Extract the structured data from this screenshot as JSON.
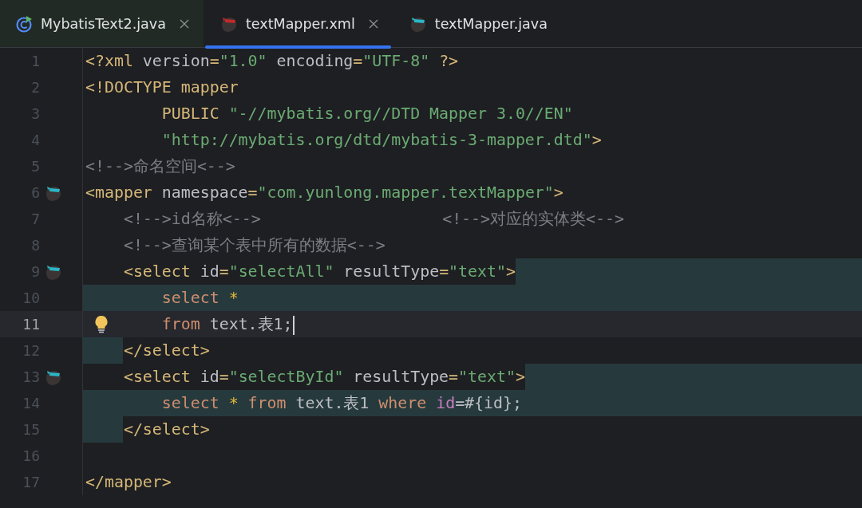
{
  "tabs": [
    {
      "label": "MybatisText2.java",
      "kind": "java",
      "selected": false,
      "tinted": true,
      "closable": true
    },
    {
      "label": "textMapper.xml",
      "kind": "xml",
      "selected": true,
      "tinted": false,
      "closable": true
    },
    {
      "label": "textMapper.java",
      "kind": "mapper",
      "selected": false,
      "tinted": false,
      "closable": false
    }
  ],
  "lines": [
    {
      "number": "1",
      "tokens": [
        {
          "kind": "tag",
          "text": "<?xml "
        },
        {
          "kind": "attr",
          "text": "version"
        },
        {
          "kind": "tag",
          "text": "="
        },
        {
          "kind": "str",
          "text": "\"1.0\""
        },
        {
          "kind": "attr",
          "text": " encoding"
        },
        {
          "kind": "tag",
          "text": "="
        },
        {
          "kind": "str",
          "text": "\"UTF-8\""
        },
        {
          "kind": "tag",
          "text": " ?>"
        }
      ]
    },
    {
      "number": "2",
      "tokens": [
        {
          "kind": "tag",
          "text": "<!DOCTYPE mapper"
        }
      ]
    },
    {
      "number": "3",
      "tokens": [
        {
          "kind": "tag",
          "text": "        PUBLIC "
        },
        {
          "kind": "str",
          "text": "\"-//mybatis.org//DTD Mapper 3.0//EN\""
        }
      ]
    },
    {
      "number": "4",
      "tokens": [
        {
          "kind": "str",
          "text": "        \"http://mybatis.org/dtd/mybatis-3-mapper.dtd\""
        },
        {
          "kind": "tag",
          "text": ">"
        }
      ]
    },
    {
      "number": "5",
      "tokens": [
        {
          "kind": "comment",
          "text": "<!-->命名空间<-->"
        }
      ]
    },
    {
      "number": "6",
      "mapper_icon": true,
      "tokens": [
        {
          "kind": "tag",
          "text": "<mapper "
        },
        {
          "kind": "attr",
          "text": "namespace"
        },
        {
          "kind": "tag",
          "text": "="
        },
        {
          "kind": "str",
          "text": "\"com.yunlong.mapper.textMapper\""
        },
        {
          "kind": "tag",
          "text": ">"
        }
      ]
    },
    {
      "number": "7",
      "tokens": [
        {
          "kind": "comment",
          "text": "    <!-->id名称<-->                   <!-->对应的实体类<-->"
        }
      ]
    },
    {
      "number": "8",
      "tokens": [
        {
          "kind": "comment",
          "text": "    <!-->查询某个表中所有的数据<-->"
        }
      ]
    },
    {
      "number": "9",
      "mapper_icon": true,
      "shade_tail": true,
      "tokens": [
        {
          "kind": "tag",
          "text": "    <select "
        },
        {
          "kind": "attr",
          "text": "id"
        },
        {
          "kind": "tag",
          "text": "="
        },
        {
          "kind": "str",
          "text": "\"selectAll\""
        },
        {
          "kind": "attr",
          "text": " resultType"
        },
        {
          "kind": "tag",
          "text": "="
        },
        {
          "kind": "str",
          "text": "\"text\""
        },
        {
          "kind": "tag",
          "text": ">"
        }
      ]
    },
    {
      "number": "10",
      "shade_full": true,
      "tokens": [
        {
          "kind": "sql",
          "text": "        select "
        },
        {
          "kind": "star",
          "text": "*"
        }
      ]
    },
    {
      "number": "11",
      "current": true,
      "caret": true,
      "bulb": true,
      "tokens": [
        {
          "kind": "sql",
          "text": "        from "
        },
        {
          "kind": "text",
          "text": "text.表1;"
        }
      ]
    },
    {
      "number": "12",
      "shade_indent": true,
      "tokens": [
        {
          "kind": "tag",
          "text": "    </select>"
        }
      ]
    },
    {
      "number": "13",
      "mapper_icon": true,
      "shade_tail": true,
      "tokens": [
        {
          "kind": "tag",
          "text": "    <select "
        },
        {
          "kind": "attr",
          "text": "id"
        },
        {
          "kind": "tag",
          "text": "="
        },
        {
          "kind": "str",
          "text": "\"selectById\""
        },
        {
          "kind": "attr",
          "text": " resultType"
        },
        {
          "kind": "tag",
          "text": "="
        },
        {
          "kind": "str",
          "text": "\"text\""
        },
        {
          "kind": "tag",
          "text": ">"
        }
      ]
    },
    {
      "number": "14",
      "shade_full": true,
      "tokens": [
        {
          "kind": "sql",
          "text": "        select "
        },
        {
          "kind": "star",
          "text": "* "
        },
        {
          "kind": "sql",
          "text": "from "
        },
        {
          "kind": "text",
          "text": "text.表1 "
        },
        {
          "kind": "sql",
          "text": "where "
        },
        {
          "kind": "param",
          "text": "id"
        },
        {
          "kind": "text",
          "text": "=#{id};"
        }
      ]
    },
    {
      "number": "15",
      "shade_indent": true,
      "tokens": [
        {
          "kind": "tag",
          "text": "    </select>"
        }
      ]
    },
    {
      "number": "16"
    },
    {
      "number": "17",
      "tokens": [
        {
          "kind": "tag",
          "text": "</mapper>"
        }
      ]
    }
  ]
}
